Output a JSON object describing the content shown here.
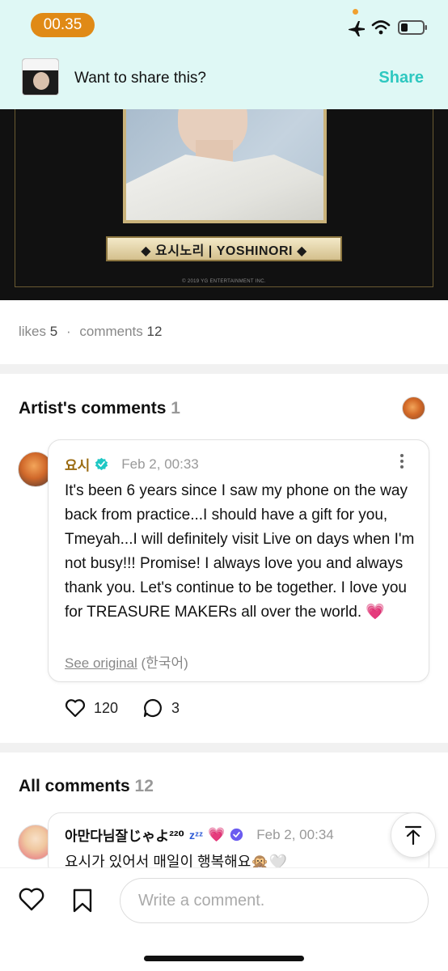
{
  "status_bar": {
    "time": "00.35"
  },
  "share_bar": {
    "prompt": "Want to share this?",
    "share_label": "Share"
  },
  "hero": {
    "nameplate": "◆ 요시노리 | YOSHINORI ◆",
    "copyright": "© 2019 YG ENTERTAINMENT INC."
  },
  "stats": {
    "likes_label": "likes",
    "likes_count": "5",
    "separator": "·",
    "comments_label": "comments",
    "comments_count": "12"
  },
  "artist_section": {
    "title": "Artist's comments",
    "count": "1"
  },
  "artist_comment": {
    "name": "요시",
    "date": "Feb 2, 00:33",
    "body": "It's been 6 years since I saw my phone on the way back from practice...I should have a gift for you, Tmeyah...I will definitely visit Live on days when I'm not busy!!! Promise! I always love you and always thank you. Let's continue to be together. I love you for TREASURE MAKERs all over the world. 💗",
    "see_original": "See original",
    "original_lang": "(한국어)",
    "likes": "120",
    "replies": "3"
  },
  "all_section": {
    "title": "All comments",
    "count": "12"
  },
  "user_comment": {
    "name": "아만다님잘じゃよ²²⁰",
    "zz": "zᶻᶻ",
    "heart": "💗",
    "date": "Feb 2, 00:34",
    "text": "요시가 있어서 매일이 행복해요🙊🤍"
  },
  "composer": {
    "placeholder": "Write a comment."
  },
  "colors": {
    "accent": "#2ec8c0",
    "artist_name": "#9a6a10",
    "status_pill": "#e08a16",
    "top_bg": "#dff8f5"
  },
  "icons": [
    "airplane-icon",
    "wifi-icon",
    "battery-icon",
    "verified-icon",
    "more-icon",
    "heart-icon",
    "comment-icon",
    "scroll-top-icon",
    "bookmark-icon"
  ]
}
